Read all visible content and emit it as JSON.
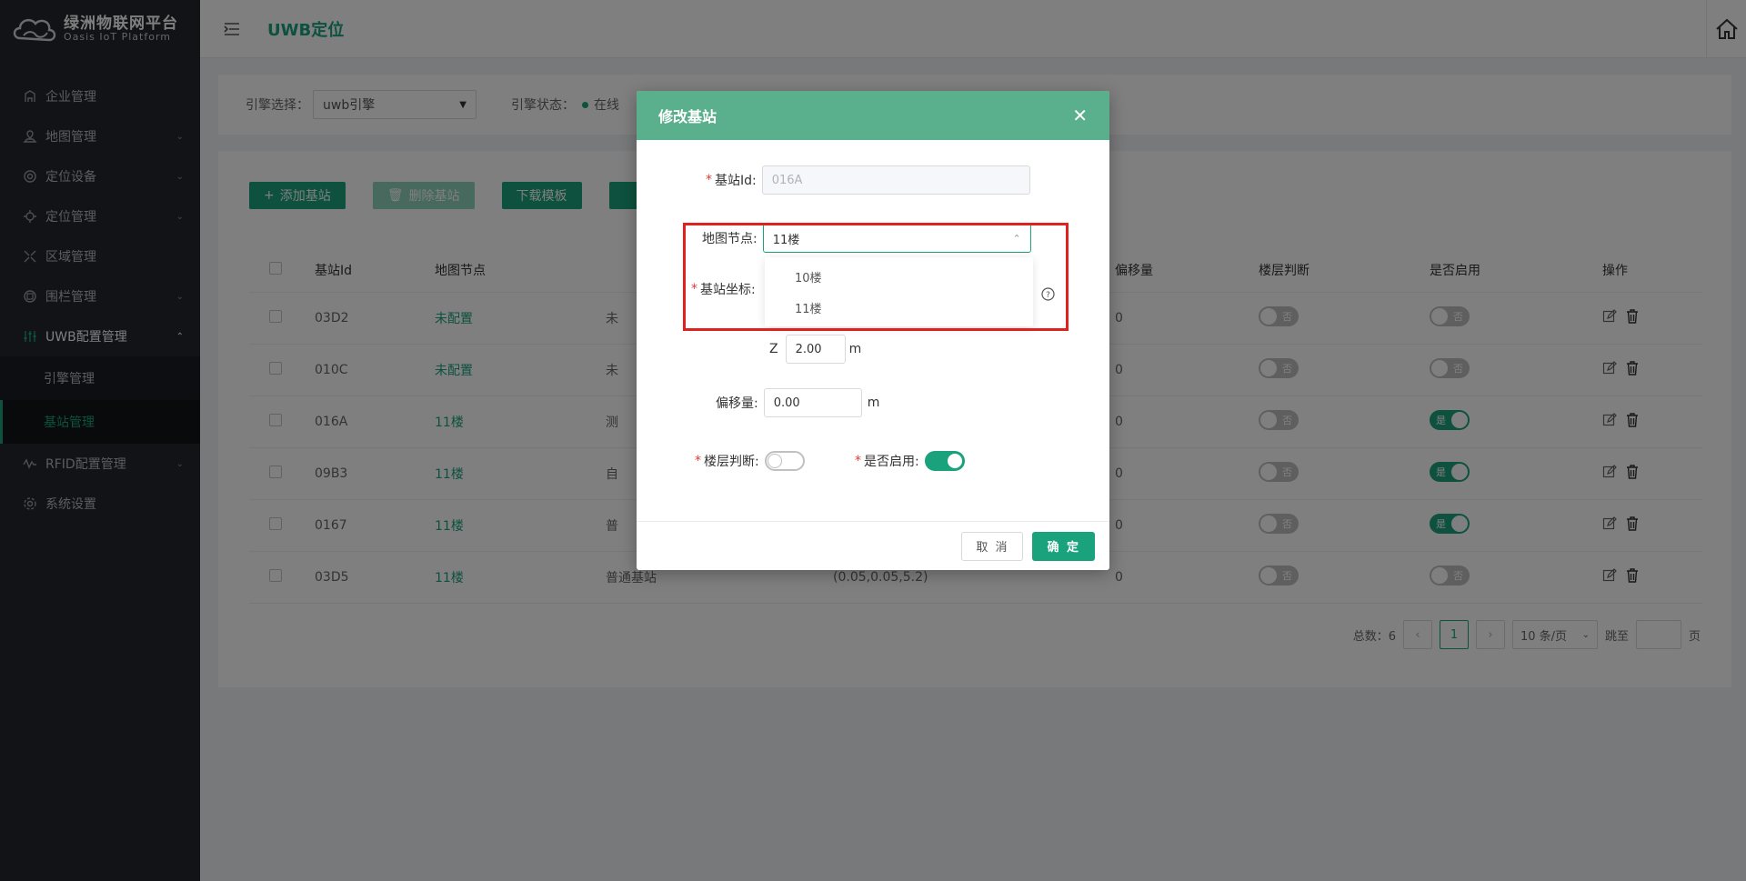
{
  "brand": {
    "name_cn": "绿洲物联网平台",
    "name_en": "Oasis IoT Platform"
  },
  "sidebar": {
    "items": [
      {
        "label": "企业管理",
        "icon": "building-icon"
      },
      {
        "label": "地图管理",
        "icon": "map-icon"
      },
      {
        "label": "定位设备",
        "icon": "target-icon"
      },
      {
        "label": "定位管理",
        "icon": "locate-icon"
      },
      {
        "label": "区域管理",
        "icon": "area-icon"
      },
      {
        "label": "围栏管理",
        "icon": "fence-icon"
      },
      {
        "label": "UWB配置管理",
        "icon": "sliders-icon"
      },
      {
        "label": "RFID配置管理",
        "icon": "wave-icon"
      },
      {
        "label": "系统设置",
        "icon": "gear-icon"
      }
    ],
    "uwb_sub": [
      {
        "label": "引擎管理"
      },
      {
        "label": "基站管理"
      }
    ]
  },
  "header": {
    "title": "UWB定位"
  },
  "filter": {
    "engine_label": "引擎选择：",
    "engine_value": "uwb引擎",
    "status_label": "引擎状态：",
    "status_value": "在线"
  },
  "toolbar": {
    "add": "添加基站",
    "delete": "删除基站",
    "download": "下载模板"
  },
  "table": {
    "headers": {
      "id": "基站Id",
      "node": "地图节点",
      "offset": "偏移量",
      "floor_judge": "楼层判断",
      "enabled": "是否启用",
      "ops": "操作"
    },
    "rows": [
      {
        "id": "03D2",
        "node": "未配置",
        "type": "未",
        "coord": "",
        "offset": "0",
        "floor": "否",
        "enabled": "否",
        "enabled_on": false
      },
      {
        "id": "010C",
        "node": "未配置",
        "type": "未",
        "coord": "",
        "offset": "0",
        "floor": "否",
        "enabled": "否",
        "enabled_on": false
      },
      {
        "id": "016A",
        "node": "11楼",
        "type": "测",
        "coord": "",
        "offset": "0",
        "floor": "否",
        "enabled": "是",
        "enabled_on": true
      },
      {
        "id": "09B3",
        "node": "11楼",
        "type": "自",
        "coord": "",
        "offset": "0",
        "floor": "否",
        "enabled": "是",
        "enabled_on": true
      },
      {
        "id": "0167",
        "node": "11楼",
        "type": "普",
        "coord": "",
        "offset": "0",
        "floor": "否",
        "enabled": "是",
        "enabled_on": true
      },
      {
        "id": "03D5",
        "node": "11楼",
        "type": "普通基站",
        "coord": "(0.05,0.05,5.2)",
        "offset": "0",
        "floor": "否",
        "enabled": "否",
        "enabled_on": false
      }
    ]
  },
  "pagination": {
    "total": "总数：6",
    "current": "1",
    "page_size": "10 条/页",
    "goto": "跳至",
    "page_unit": "页"
  },
  "modal": {
    "title": "修改基站",
    "station_id_label": "基站Id:",
    "station_id_value": "016A",
    "map_node_label": "地图节点:",
    "map_node_value": "11楼",
    "map_node_options": [
      "10楼",
      "11楼"
    ],
    "coord_label": "基站坐标:",
    "z_label": "Z",
    "z_value": "2.00",
    "z_unit": "m",
    "offset_label": "偏移量:",
    "offset_value": "0.00",
    "offset_unit": "m",
    "floor_judge_label": "楼层判断:",
    "enabled_label": "是否启用:",
    "cancel": "取 消",
    "ok": "确 定"
  },
  "colors": {
    "accent": "#1aa27c",
    "modal_header": "#5aaf8c",
    "sidebar_bg": "#23262e",
    "highlight_border": "#e0221f"
  }
}
